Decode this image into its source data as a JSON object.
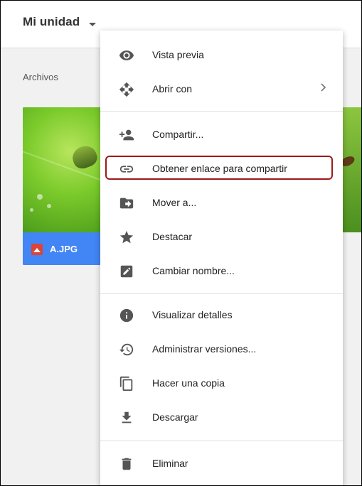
{
  "header": {
    "title": "Mi unidad"
  },
  "main": {
    "section_label": "Archivos",
    "files": [
      {
        "name": "A.JPG",
        "type_icon": "image-icon"
      }
    ]
  },
  "context_menu": {
    "items": [
      {
        "label": "Vista previa",
        "icon": "eye-icon"
      },
      {
        "label": "Abrir con",
        "icon": "move-arrows-icon",
        "has_submenu": true
      },
      {
        "label": "Compartir...",
        "icon": "person-add-icon"
      },
      {
        "label": "Obtener enlace para compartir",
        "icon": "link-icon",
        "highlighted": true
      },
      {
        "label": "Mover a...",
        "icon": "folder-move-icon"
      },
      {
        "label": "Destacar",
        "icon": "star-icon"
      },
      {
        "label": "Cambiar nombre...",
        "icon": "edit-icon"
      },
      {
        "label": "Visualizar detalles",
        "icon": "info-icon"
      },
      {
        "label": "Administrar versiones...",
        "icon": "history-icon"
      },
      {
        "label": "Hacer una copia",
        "icon": "copy-icon"
      },
      {
        "label": "Descargar",
        "icon": "download-icon"
      },
      {
        "label": "Eliminar",
        "icon": "trash-icon"
      }
    ]
  },
  "colors": {
    "highlight_border": "#9b1a1a",
    "file_card_bg": "#4285f4",
    "file_icon_red": "#db4437",
    "menu_icon": "#555555",
    "menu_text": "#212121"
  }
}
